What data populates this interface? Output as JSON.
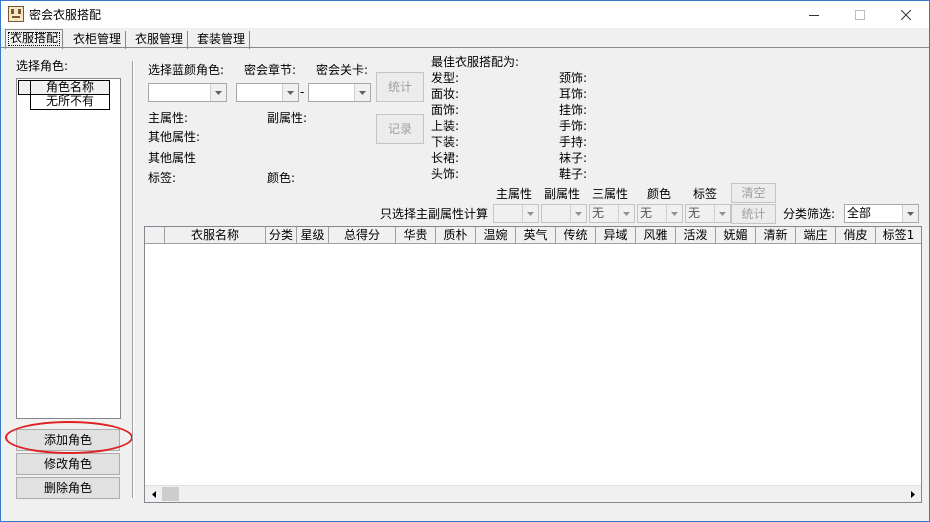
{
  "window": {
    "title": "密会衣服搭配",
    "controls": {
      "minimize_icon": "minimize-icon",
      "maximize_icon": "maximize-icon",
      "close_icon": "close-icon"
    }
  },
  "tabs": [
    {
      "label": "衣服搭配",
      "active": true
    },
    {
      "label": "衣柜管理",
      "active": false
    },
    {
      "label": "衣服管理",
      "active": false
    },
    {
      "label": "套装管理",
      "active": false
    }
  ],
  "left_panel": {
    "select_role_label": "选择角色:",
    "list_header": "角色名称",
    "list_items": [
      "无所不有"
    ],
    "add_button": "添加角色",
    "edit_button": "修改角色",
    "delete_button": "删除角色"
  },
  "selectors": {
    "blue_role_label": "选择蓝颜角色:",
    "chapter_label": "密会章节:",
    "level_label": "密会关卡:",
    "dash": "-",
    "stats_button": "统计",
    "record_button": "记录"
  },
  "attributes": {
    "main_label": "主属性:",
    "sub_label": "副属性:",
    "other_label1": "其他属性:",
    "other_label2": "其他属性",
    "tag_label": "标签:",
    "color_label": "颜色:"
  },
  "best": {
    "title": "最佳衣服搭配为:",
    "left": [
      "发型:",
      "面妆:",
      "面饰:",
      "上装:",
      "下装:",
      "长裙:",
      "头饰:"
    ],
    "right": [
      "颈饰:",
      "耳饰:",
      "挂饰:",
      "手饰:",
      "手持:",
      "袜子:",
      "鞋子:"
    ]
  },
  "filter": {
    "main_attr": "主属性",
    "sub_attr": "副属性",
    "third_attr": "三属性",
    "color": "颜色",
    "tag": "标签",
    "clear_button": "清空",
    "only_label": "只选择主副属性计算",
    "none_value": "无",
    "stats_button": "统计",
    "category_label": "分类筛选:",
    "category_value": "全部"
  },
  "table": {
    "columns": [
      "",
      "衣服名称",
      "分类",
      "星级",
      "总得分",
      "华贵",
      "质朴",
      "温婉",
      "英气",
      "传统",
      "异域",
      "风雅",
      "活泼",
      "妩媚",
      "清新",
      "端庄",
      "俏皮",
      "标签1"
    ],
    "rows": []
  }
}
